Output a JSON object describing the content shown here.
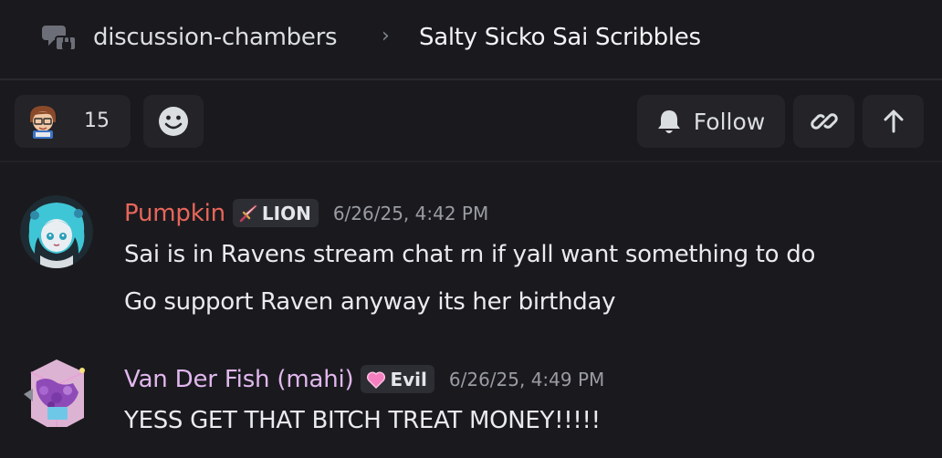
{
  "header": {
    "parent_channel": "discussion-chambers",
    "separator": "›",
    "current_thread": "Salty Sicko Sai Scribbles",
    "icon": "forum-icon"
  },
  "toolbar": {
    "member_count": "15",
    "emoji_icon": "smiley-icon",
    "follow_label": "Follow",
    "follow_icon": "bell-icon",
    "link_icon": "link-icon",
    "up_icon": "arrow-up-icon"
  },
  "messages": [
    {
      "username": "Pumpkin",
      "username_color": "#e8665a",
      "tag_icon": "sword-icon",
      "tag": "LION",
      "timestamp": "6/26/25, 4:42 PM",
      "lines": [
        "Sai is in Ravens stream chat rn if yall want something to do",
        "Go support Raven anyway its her birthday"
      ]
    },
    {
      "username": "Van Der Fish (mahi)",
      "username_color": "#e2b7ef",
      "tag_icon": "heart-icon",
      "tag": "Evil",
      "timestamp": "6/26/25, 4:49 PM",
      "lines": [
        "YESS GET THAT BITCH TREAT MONEY!!!!!"
      ]
    }
  ]
}
